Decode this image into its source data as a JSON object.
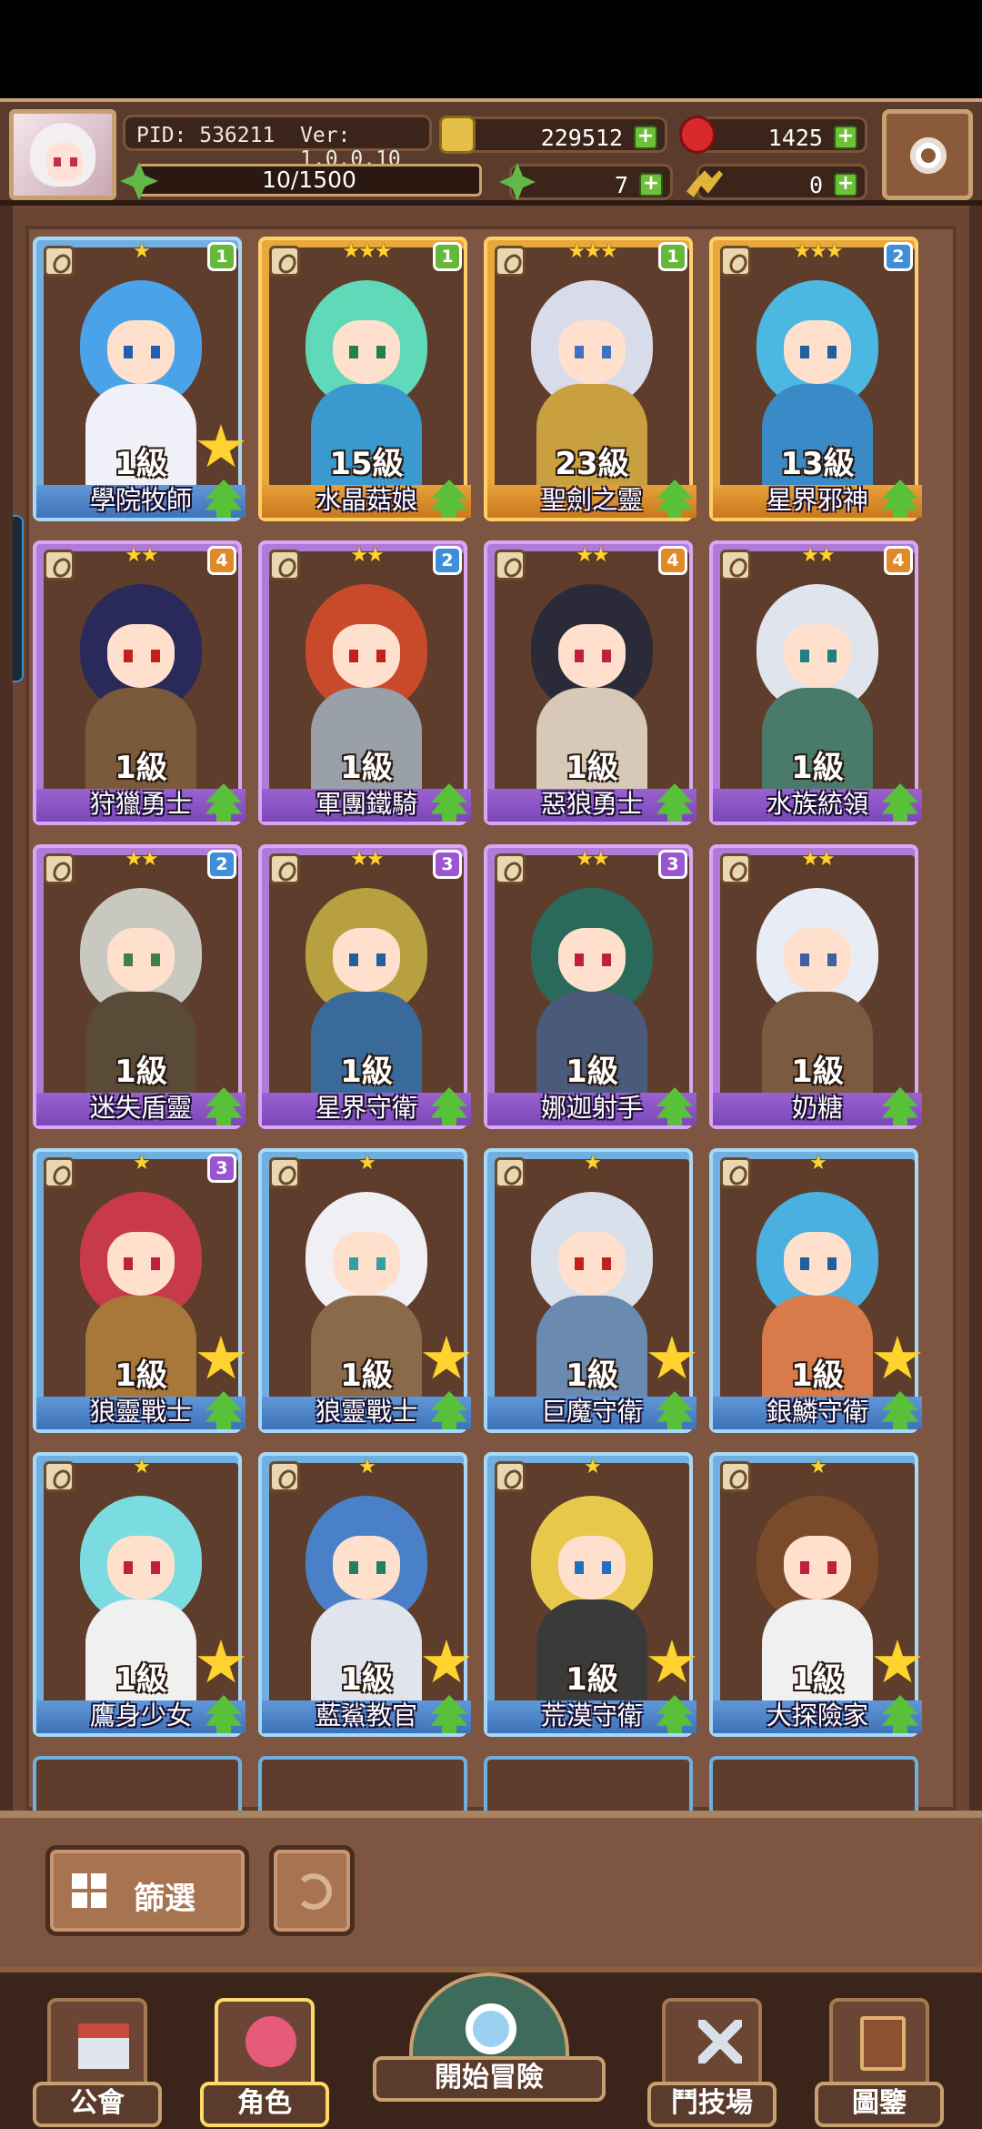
{
  "header": {
    "pid": "PID: 536211",
    "version": "Ver: 1.0.0.10",
    "energy": "10/1500",
    "gold": "229512",
    "gems": "1425",
    "clovers": "7",
    "keys": "0"
  },
  "cards": [
    {
      "name": "學院牧師",
      "level": "1級",
      "stars": "★",
      "badge": "1",
      "badge_color": "green",
      "rarity": "blue",
      "big_star": true,
      "hair": "#4aa3e8",
      "body": "#f0f0f8",
      "eye": "#2060b0"
    },
    {
      "name": "水晶菇娘",
      "level": "15級",
      "stars": "★★★",
      "badge": "1",
      "badge_color": "green",
      "rarity": "gold",
      "big_star": false,
      "hair": "#5fd9b8",
      "body": "#3a9ad0",
      "eye": "#208050"
    },
    {
      "name": "聖劍之靈",
      "level": "23級",
      "stars": "★★★",
      "badge": "1",
      "badge_color": "green",
      "rarity": "gold",
      "big_star": false,
      "hair": "#d8dcea",
      "body": "#c8a040",
      "eye": "#4070c0"
    },
    {
      "name": "星界邪神",
      "level": "13級",
      "stars": "★★★",
      "badge": "2",
      "badge_color": "blue",
      "rarity": "gold",
      "big_star": false,
      "hair": "#4ab8e0",
      "body": "#3a8ac8",
      "eye": "#2060a0"
    },
    {
      "name": "狩獵勇士",
      "level": "1級",
      "stars": "★★",
      "badge": "4",
      "badge_color": "orange",
      "rarity": "purple",
      "big_star": false,
      "hair": "#2a2a5a",
      "body": "#7a5a3a",
      "eye": "#c02020"
    },
    {
      "name": "軍團鐵騎",
      "level": "1級",
      "stars": "★★",
      "badge": "2",
      "badge_color": "blue",
      "rarity": "purple",
      "big_star": false,
      "hair": "#c84a2a",
      "body": "#9aa0a8",
      "eye": "#c02020"
    },
    {
      "name": "惡狼勇士",
      "level": "1級",
      "stars": "★★",
      "badge": "4",
      "badge_color": "orange",
      "rarity": "purple",
      "big_star": false,
      "hair": "#2a2a38",
      "body": "#d8c8b8",
      "eye": "#c02040"
    },
    {
      "name": "水族統領",
      "level": "1級",
      "stars": "★★",
      "badge": "4",
      "badge_color": "orange",
      "rarity": "purple",
      "big_star": false,
      "hair": "#e0e4ec",
      "body": "#4a7a6a",
      "eye": "#208080"
    },
    {
      "name": "迷失盾靈",
      "level": "1級",
      "stars": "★★",
      "badge": "2",
      "badge_color": "blue",
      "rarity": "purple",
      "big_star": false,
      "hair": "#c8c8c0",
      "body": "#5a4a38",
      "eye": "#408040"
    },
    {
      "name": "星界守衛",
      "level": "1級",
      "stars": "★★",
      "badge": "3",
      "badge_color": "purple",
      "rarity": "purple",
      "big_star": false,
      "hair": "#b8a040",
      "body": "#3a6a9a",
      "eye": "#2060a0"
    },
    {
      "name": "娜迦射手",
      "level": "1級",
      "stars": "★★",
      "badge": "3",
      "badge_color": "purple",
      "rarity": "purple",
      "big_star": false,
      "hair": "#2a6a5a",
      "body": "#4a5a7a",
      "eye": "#c02040"
    },
    {
      "name": "奶糖",
      "level": "1級",
      "stars": "★★",
      "badge": "",
      "badge_color": "",
      "rarity": "purple",
      "big_star": false,
      "hair": "#e8ecf4",
      "body": "#7a5a40",
      "eye": "#4060a0"
    },
    {
      "name": "狼靈戰士",
      "level": "1級",
      "stars": "★",
      "badge": "3",
      "badge_color": "purple",
      "rarity": "blue",
      "big_star": true,
      "hair": "#c83a4a",
      "body": "#a8783a",
      "eye": "#c02040"
    },
    {
      "name": "狼靈戰士",
      "level": "1級",
      "stars": "★",
      "badge": "",
      "badge_color": "",
      "rarity": "blue",
      "big_star": true,
      "hair": "#f0f0f4",
      "body": "#8a6a4a",
      "eye": "#30a0a0"
    },
    {
      "name": "巨魔守衛",
      "level": "1級",
      "stars": "★",
      "badge": "",
      "badge_color": "",
      "rarity": "blue",
      "big_star": true,
      "hair": "#d8e0ec",
      "body": "#6a8ab0",
      "eye": "#c02020"
    },
    {
      "name": "銀鱗守衛",
      "level": "1級",
      "stars": "★",
      "badge": "",
      "badge_color": "",
      "rarity": "blue",
      "big_star": true,
      "hair": "#4ab0e0",
      "body": "#d87a4a",
      "eye": "#2060a0"
    },
    {
      "name": "鷹身少女",
      "level": "1級",
      "stars": "★",
      "badge": "",
      "badge_color": "",
      "rarity": "blue",
      "big_star": true,
      "hair": "#7adce0",
      "body": "#f0f0f0",
      "eye": "#c02040"
    },
    {
      "name": "藍鯊教官",
      "level": "1級",
      "stars": "★",
      "badge": "",
      "badge_color": "",
      "rarity": "blue",
      "big_star": true,
      "hair": "#4a80c8",
      "body": "#e0e4ec",
      "eye": "#208060"
    },
    {
      "name": "荒漠守衛",
      "level": "1級",
      "stars": "★",
      "badge": "",
      "badge_color": "",
      "rarity": "blue",
      "big_star": true,
      "hair": "#e8c84a",
      "body": "#3a3a3a",
      "eye": "#2070c0"
    },
    {
      "name": "大探險家",
      "level": "1級",
      "stars": "★",
      "badge": "",
      "badge_color": "",
      "rarity": "blue",
      "big_star": true,
      "hair": "#7a4a2a",
      "body": "#f0f0f0",
      "eye": "#c02040"
    }
  ],
  "filter": {
    "label": "篩選"
  },
  "nav": {
    "guild": "公會",
    "character": "角色",
    "adventure": "開始冒險",
    "arena": "鬥技場",
    "codex": "圖鑒"
  }
}
